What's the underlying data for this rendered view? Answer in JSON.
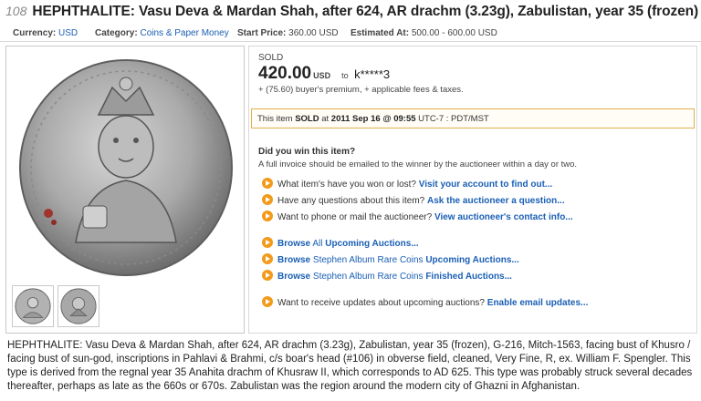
{
  "lot": {
    "number": "108",
    "title": "HEPHTHALITE: Vasu Deva & Mardan Shah, after 624, AR drachm (3.23g), Zabulistan, year 35 (frozen)"
  },
  "meta": {
    "currency_label": "Currency:",
    "currency_value": "USD",
    "category_label": "Category:",
    "category_value": "Coins & Paper Money",
    "start_price_label": "Start Price:",
    "start_price_value": "360.00 USD",
    "estimated_label": "Estimated At:",
    "estimated_value": "500.00 - 600.00 USD"
  },
  "sale": {
    "status": "SOLD",
    "price": "420.00",
    "currency": "USD",
    "to_word": "to",
    "buyer": "k*****3",
    "premium_note": "+ (75.60) buyer's premium, + applicable fees & taxes.",
    "sold_prefix": "This item",
    "sold_word": "SOLD",
    "sold_at": "at",
    "sold_date": "2011 Sep 16 @ 09:55",
    "sold_tz": "UTC-7 : PDT/MST"
  },
  "win": {
    "question": "Did you win this item?",
    "note": "A full invoice should be emailed to the winner by the auctioneer within a day or two."
  },
  "actions": [
    {
      "text": "What item's have you won or lost?",
      "link": "Visit your account to find out..."
    },
    {
      "text": "Have any questions about this item?",
      "link": "Ask the auctioneer a question..."
    },
    {
      "text": "Want to phone or mail the auctioneer?",
      "link": "View auctioneer's contact info..."
    }
  ],
  "browse": [
    {
      "a": "Browse",
      "b": "All",
      "c": "Upcoming Auctions..."
    },
    {
      "a": "Browse",
      "b": "Stephen Album Rare Coins",
      "c": "Upcoming Auctions..."
    },
    {
      "a": "Browse",
      "b": "Stephen Album Rare Coins",
      "c": "Finished Auctions..."
    }
  ],
  "updates": {
    "text": "Want to receive updates about upcoming auctions?",
    "link": "Enable email updates..."
  },
  "description": "HEPHTHALITE: Vasu Deva & Mardan Shah, after 624, AR drachm (3.23g), Zabulistan, year 35 (frozen), G-216, Mitch-1563, facing bust of Khusro / facing bust of sun-god, inscriptions in Pahlavi & Brahmi, c/s boar's head (#106) in obverse field, cleaned, Very Fine, R, ex. William F. Spengler. This type is derived from the regnal year 35 Anahita drachm of Khusraw II, which corresponds to AD 625. This type was probably struck several decades thereafter, perhaps as late as the 660s or 670s. Zabulistan was the region around the modern city of Ghazni in Afghanistan.",
  "colors": {
    "link": "#1a5fb4",
    "arrow_icon": "#f29a1a",
    "sold_box_border": "#e0b050"
  }
}
